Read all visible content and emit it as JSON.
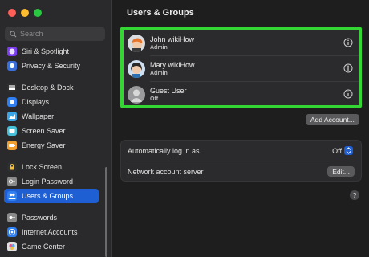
{
  "window": {
    "title": "Users & Groups"
  },
  "search": {
    "placeholder": "Search"
  },
  "sidebar": {
    "items": [
      {
        "label": "Siri & Spotlight",
        "icon": "siri-icon",
        "color": "#7b3ef0"
      },
      {
        "label": "Privacy & Security",
        "icon": "hand-icon",
        "color": "#3a6fd8"
      },
      {
        "label": "Desktop & Dock",
        "icon": "dock-icon",
        "color": "#2f2f2f"
      },
      {
        "label": "Displays",
        "icon": "sun-icon",
        "color": "#2f7ff0"
      },
      {
        "label": "Wallpaper",
        "icon": "wallpaper-icon",
        "color": "#3aa6e8"
      },
      {
        "label": "Screen Saver",
        "icon": "screensaver-icon",
        "color": "#46c0d8"
      },
      {
        "label": "Energy Saver",
        "icon": "battery-icon",
        "color": "#f0a030"
      },
      {
        "label": "Lock Screen",
        "icon": "lock-icon",
        "color": "#2f2f2f"
      },
      {
        "label": "Login Password",
        "icon": "key-icon",
        "color": "#8a8a8a"
      },
      {
        "label": "Users & Groups",
        "icon": "users-icon",
        "color": "#2f7ff0",
        "active": true
      },
      {
        "label": "Passwords",
        "icon": "passwords-icon",
        "color": "#8a8a8a"
      },
      {
        "label": "Internet Accounts",
        "icon": "at-icon",
        "color": "#2f7ff0"
      },
      {
        "label": "Game Center",
        "icon": "game-center-icon",
        "color": "#e0e0e0"
      }
    ]
  },
  "users": [
    {
      "name": "John wikiHow",
      "role": "Admin"
    },
    {
      "name": "Mary wikiHow",
      "role": "Admin"
    },
    {
      "name": "Guest User",
      "role": "Off"
    }
  ],
  "buttons": {
    "add_account": "Add Account...",
    "edit": "Edit..."
  },
  "settings": {
    "auto_login_label": "Automatically log in as",
    "auto_login_value": "Off",
    "network_server_label": "Network account server"
  },
  "help": "?",
  "colors": {
    "accent": "#1f5fd4",
    "highlight_border": "#33d633"
  }
}
